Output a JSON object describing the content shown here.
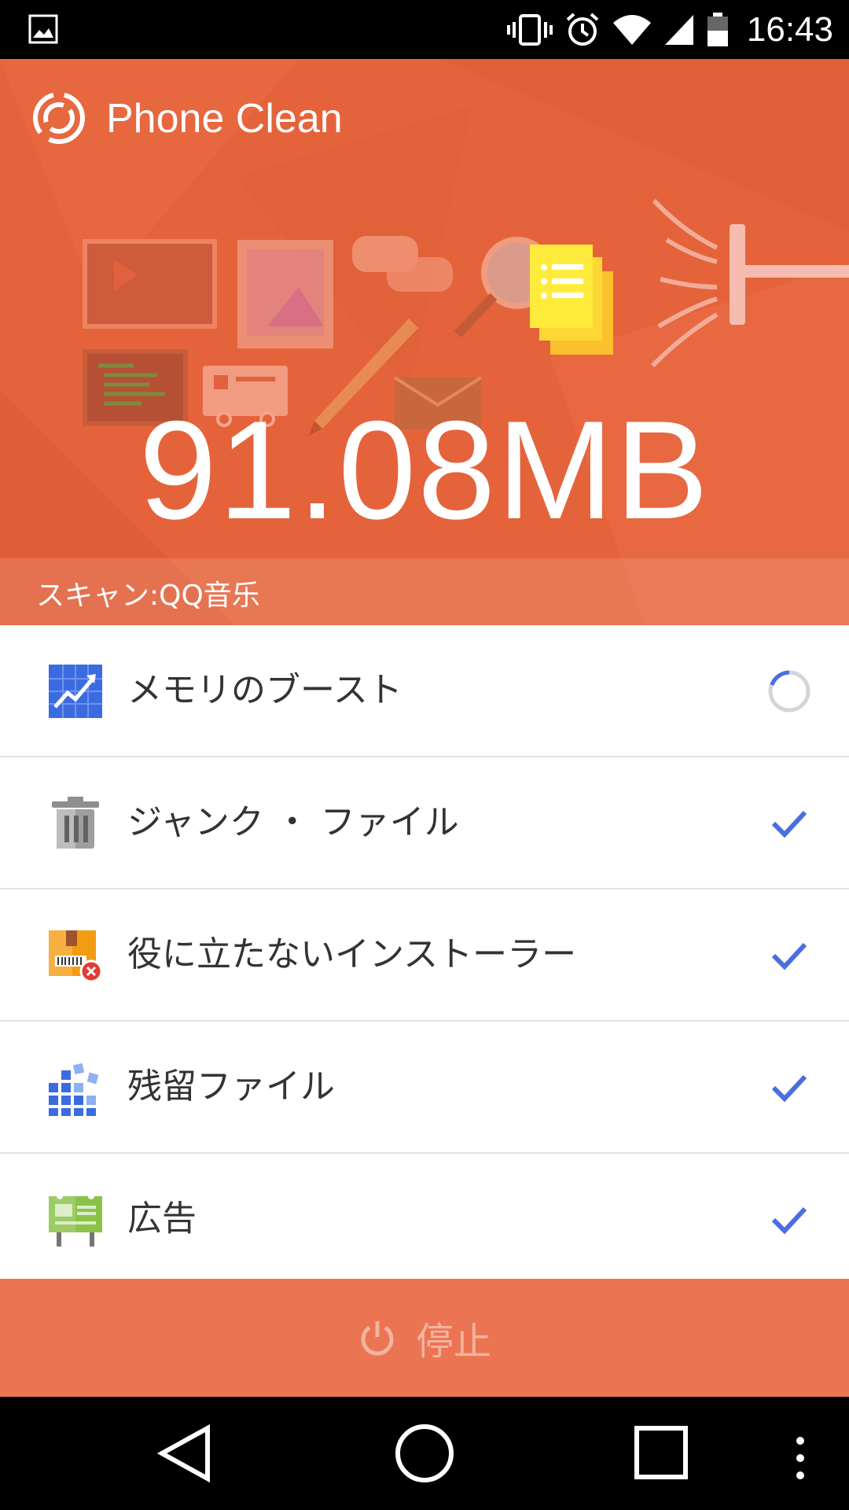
{
  "status_bar": {
    "time": "16:43",
    "icons": [
      "gallery-icon",
      "vibrate-icon",
      "alarm-icon",
      "wifi-icon",
      "signal-icon",
      "battery-icon"
    ]
  },
  "header": {
    "app_title": "Phone Clean",
    "scanned_size": "91.08MB",
    "scan_status": "スキャン:QQ音乐",
    "background_color": "#e5633b"
  },
  "scan_items": [
    {
      "label": "メモリのブースト",
      "icon": "memory-boost-icon",
      "status": "scanning"
    },
    {
      "label": "ジャンク ・ ファイル",
      "icon": "trash-icon",
      "status": "done"
    },
    {
      "label": "役に立たないインストーラー",
      "icon": "package-icon",
      "status": "done"
    },
    {
      "label": "残留ファイル",
      "icon": "residual-blocks-icon",
      "status": "done"
    },
    {
      "label": "広告",
      "icon": "billboard-icon",
      "status": "done"
    }
  ],
  "stop_button": {
    "label": "停止",
    "icon": "power-icon",
    "color": "#eb7553"
  },
  "accent_color": "#4a6ee0",
  "nav_bar": {
    "buttons": [
      "back-icon",
      "home-icon",
      "recents-icon",
      "menu-icon"
    ]
  }
}
